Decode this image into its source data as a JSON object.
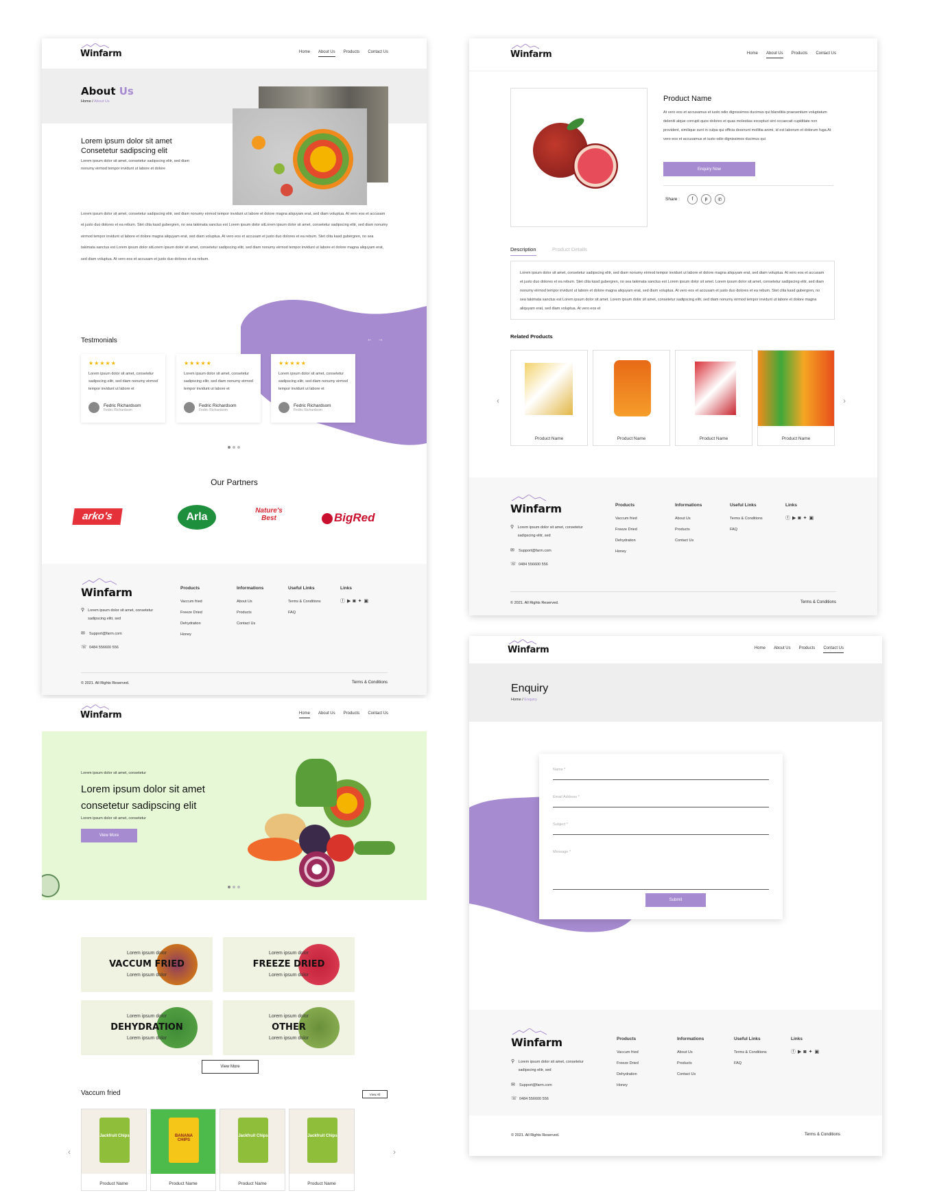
{
  "brand": "Winfarm",
  "nav": {
    "home": "Home",
    "about": "About Us",
    "products": "Products",
    "contact": "Contact Us"
  },
  "about": {
    "title_a": "About ",
    "title_b": "Us",
    "crumb_home": "Home /",
    "crumb_current": "About Us",
    "headline": "Lorem ipsum dolor sit amet Consetetur sadipscing elit",
    "sub": "Lorem ipsum dolor sit amet, consetetur sadipscing elitr, sed diam nonumy eirmod tempor invidunt ut labore et dolore",
    "body": "Lorem ipsum dolor sit amet, consetetur sadipscing elitr, sed diam nonumy eirmod tempor invidunt ut labore et dolore magna aliquyam erat, sed diam voluptua. At vero eos et accusam et justo duo dolores et ea rebum. Stet clita kasd gubergren, no sea takimata sanctus est Lorem ipsum dolor sitLorem ipsum dolor sit amet, consetetur sadipscing elitr, sed diam nonumy eirmod tempor invidunt ut labore et dolore magna aliquyam erat, sed diam voluptua. At vero eos et accusam et justo duo dolores et ea rebum. Stet clita kasd gubergren, no sea takimata sanctus est Lorem ipsum dolor sitLorem ipsum dolor sit amet, consetetur sadipscing elitr, sed diam nonumy eirmod tempor invidunt ut labore et dolore magna aliquyam erat, sed diam voluptua. At vero eos et accusam et justo duo dolores et ea rebum.",
    "testimonials_title": "Testmonials",
    "testimonials": [
      {
        "stars": "★★★★★",
        "text": "Lorem ipsum dolor sit amet, consetetur sadipscing elitr, sed diam nonumy eirmod tempor invidunt ut labore et",
        "name": "Fedric Richardsom",
        "role": "Fedric Richardsom"
      },
      {
        "stars": "★★★★★",
        "text": "Lorem ipsum dolor sit amet, consetetur sadipscing elitr, sed diam nonumy eirmod tempor invidunt ut labore et",
        "name": "Fedric Richardsom",
        "role": "Fedric Richardsom"
      },
      {
        "stars": "★★★★★",
        "text": "Lorem ipsum dolor sit amet, consetetur sadipscing elitr, sed diam nonumy eirmod tempor invidunt ut labore et",
        "name": "Fedric Richardsom",
        "role": "Fedric Richardsom"
      }
    ],
    "partners_title": "Our Partners",
    "partners": [
      "arko's",
      "Arla",
      "Nature's Best",
      "BigRed"
    ]
  },
  "footer": {
    "address": "Lorem ipsum dolor sit amet, consetetur sadipscing elitr, sed",
    "email": "Support@farm.com",
    "phone": "0484 556600 556",
    "col_products": "Products",
    "products": [
      "Vaccum fried",
      "Freeze Dried",
      "Dehydration",
      "Honey"
    ],
    "col_info": "Informations",
    "info": [
      "About Us",
      "Products",
      "Contact Us"
    ],
    "col_useful": "Useful Links",
    "useful": [
      "Terms & Conditions",
      "FAQ"
    ],
    "col_links": "Links",
    "copyright": "© 2021. All Rights Reserved.",
    "terms": "Terms & Conditions"
  },
  "product": {
    "name": "Product Name",
    "desc": "At vero eos et accusamus et iusto odio dignissimos ducimus qui blanditiis praesentium voluptatum deleniti atque corrupti quos dolores et quas molestias excepturi sint occaecati cupiditate non provident, similique sunt in culpa qui officia deserunt mollitia animi, id est laborum et dolorum fuga.At vero eos et accusamus et iusto odio dignissimos ducimus qui",
    "enquiry_btn": "Enquiry Now",
    "share": "Share :",
    "tab_desc": "Description",
    "tab_details": "Product Details",
    "description_text": "Lorem ipsum dolor sit amet, consetetur sadipscing elitr, sed diam nonumy eirmod tempor invidunt ut labore et dolore magna aliquyam erat, sed diam voluptua. At vero eos et accusam et justo duo dolores et ea rebum. Stet clita kasd gubergren, no sea takimata sanctus est Lorem ipsum dolor sit amet. Lorem ipsum dolor sit amet, consetetur sadipscing elitr, sed diam nonumy eirmod tempor invidunt ut labore et dolore magna aliquyam erat, sed diam voluptua. At vero eos et accusam et justo duo dolores et ea rebum. Stet clita kasd gubergren, no sea takimata sanctus est Lorem ipsum dolor sit amet. Lorem ipsum dolor sit amet, consetetur sadipscing elitr, sed diam nonumy eirmod tempor invidunt ut labore et dolore magna aliquyam erat, sed diam voluptua. At vero eos et",
    "related_title": "Related Products",
    "related": [
      "Product Name",
      "Product Name",
      "Product Name",
      "Product Name"
    ]
  },
  "enquiry": {
    "title": "Enquiry",
    "crumb_home": "Home /",
    "crumb_current": "Enquiry",
    "name_ph": "Name *",
    "email_ph": "Email Address *",
    "subject_ph": "Subject *",
    "message_ph": "Message *",
    "submit": "Submit"
  },
  "home": {
    "hero_small": "Lorem ipsum dolor sit amet, consetetur",
    "hero_title": "Lorem ipsum dolor sit amet consetetur sadipscing elit",
    "hero_small2": "Lorem ipsum dolor sit amet, consetetur",
    "hero_btn": "View More",
    "categories": [
      {
        "top": "Lorem ipsum dolor",
        "name": "VACCUM FRIED",
        "bottom": "Lorem ipsum dolor"
      },
      {
        "top": "Lorem ipsum dolor",
        "name": "FREEZE DRIED",
        "bottom": "Lorem ipsum dolor"
      },
      {
        "top": "Lorem ipsum dolor",
        "name": "DEHYDRATION",
        "bottom": "Lorem ipsum dolor"
      },
      {
        "top": "Lorem ipsum dolor",
        "name": "OTHER",
        "bottom": "Lorem ipsum dolor"
      }
    ],
    "view_more": "View More",
    "vaccum_title": "Vaccum fried",
    "view_all": "View All",
    "products": [
      "Product Name",
      "Product Name",
      "Product Name",
      "Product Name"
    ],
    "pack_label": "Jackfruit Chips",
    "pack_label2": "BANANA CHIPS"
  },
  "colors": {
    "accent": "#a78bd0",
    "hero_bg": "#e6f8d6",
    "footer_bg": "#f7f7f7"
  }
}
